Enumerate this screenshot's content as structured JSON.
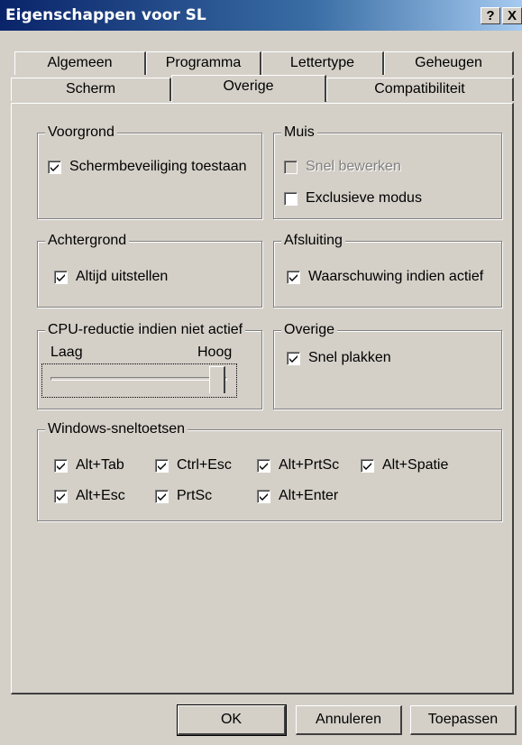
{
  "window": {
    "title": "Eigenschappen voor SL",
    "help_label": "?",
    "close_label": "X"
  },
  "tabs_back": [
    "Algemeen",
    "Programma",
    "Lettertype",
    "Geheugen"
  ],
  "tabs_front": [
    "Scherm",
    "Overige",
    "Compatibiliteit"
  ],
  "active_tab": "Overige",
  "groups": {
    "voorgrond": {
      "legend": "Voorgrond",
      "items": [
        {
          "label": "Schermbeveiliging toestaan",
          "checked": true,
          "enabled": true
        }
      ]
    },
    "muis": {
      "legend": "Muis",
      "items": [
        {
          "label": "Snel bewerken",
          "checked": false,
          "enabled": false
        },
        {
          "label": "Exclusieve modus",
          "checked": false,
          "enabled": true
        }
      ]
    },
    "achtergrond": {
      "legend": "Achtergrond",
      "items": [
        {
          "label": "Altijd uitstellen",
          "checked": true,
          "enabled": true
        }
      ]
    },
    "afsluiting": {
      "legend": "Afsluiting",
      "items": [
        {
          "label": "Waarschuwing indien actief",
          "checked": true,
          "enabled": true
        }
      ]
    },
    "cpu": {
      "legend": "CPU-reductie indien niet actief",
      "low_label": "Laag",
      "high_label": "Hoog",
      "level": 1.0
    },
    "overige": {
      "legend": "Overige",
      "items": [
        {
          "label": "Snel plakken",
          "checked": true,
          "enabled": true
        }
      ]
    },
    "sneltoetsen": {
      "legend": "Windows-sneltoetsen",
      "items": [
        {
          "label": "Alt+Tab",
          "checked": true
        },
        {
          "label": "Ctrl+Esc",
          "checked": true
        },
        {
          "label": "Alt+PrtSc",
          "checked": true
        },
        {
          "label": "Alt+Spatie",
          "checked": true
        },
        {
          "label": "Alt+Esc",
          "checked": true
        },
        {
          "label": "PrtSc",
          "checked": true
        },
        {
          "label": "Alt+Enter",
          "checked": true
        }
      ]
    }
  },
  "buttons": {
    "ok": "OK",
    "cancel": "Annuleren",
    "apply": "Toepassen"
  }
}
